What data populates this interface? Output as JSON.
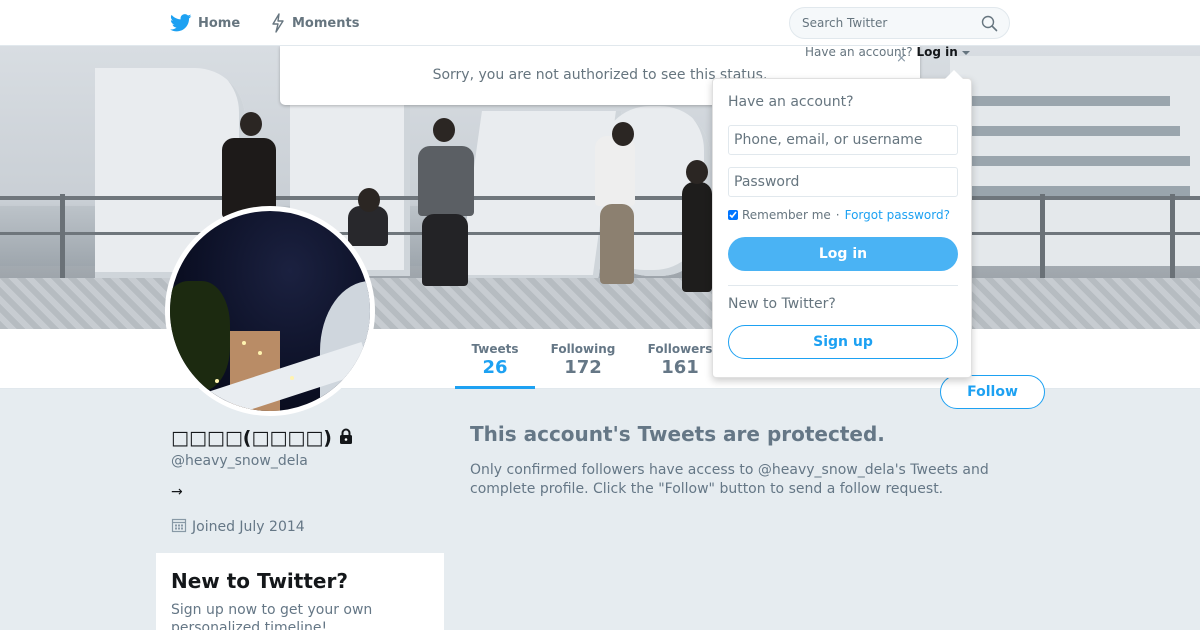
{
  "nav": {
    "home_label": "Home",
    "moments_label": "Moments",
    "search_placeholder": "Search Twitter",
    "icons": {
      "home": "twitter-bird-icon",
      "moments": "lightning-icon",
      "search": "search-icon"
    }
  },
  "error": {
    "message": "Sorry, you are not authorized to see this status.",
    "close_label": "×"
  },
  "account_toggle": {
    "prompt": "Have an account?",
    "action": "Log in"
  },
  "login_dropdown": {
    "heading": "Have an account?",
    "username_placeholder": "Phone, email, or username",
    "password_placeholder": "Password",
    "remember_label": "Remember me",
    "separator": "·",
    "forgot_label": "Forgot password?",
    "login_button": "Log in",
    "new_heading": "New to Twitter?",
    "signup_button": "Sign up"
  },
  "profile_nav": {
    "stats": [
      {
        "label": "Tweets",
        "value": "26"
      },
      {
        "label": "Following",
        "value": "172"
      },
      {
        "label": "Followers",
        "value": "161"
      }
    ],
    "follow_button": "Follow"
  },
  "profile": {
    "name": "□□□□(□□□□)",
    "screen_name": "@heavy_snow_dela",
    "bio": "→",
    "joined": "Joined July 2014",
    "icons": {
      "protected": "lock-icon",
      "joined": "calendar-icon"
    }
  },
  "signup_card": {
    "title": "New to Twitter?",
    "body": "Sign up now to get your own personalized timeline!"
  },
  "protected": {
    "title": "This account's Tweets are protected.",
    "body": "Only confirmed followers have access to @heavy_snow_dela's Tweets and complete profile. Click the \"Follow\" button to send a follow request."
  },
  "colors": {
    "brand": "#1da1f2",
    "background": "#e6ecf0",
    "text_secondary": "#657786"
  }
}
